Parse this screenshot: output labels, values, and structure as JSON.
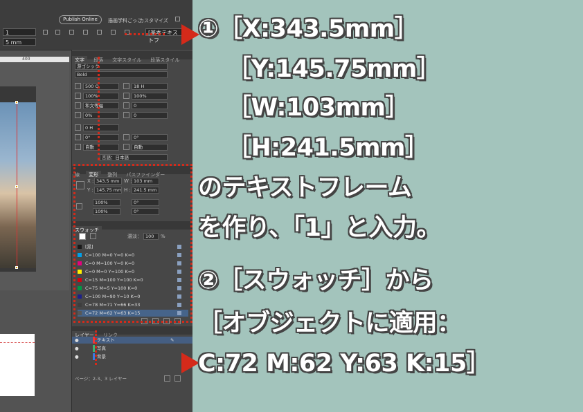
{
  "topbar": {
    "publish_label": "Publish Online",
    "title_text": "描画学科ごっこ",
    "menu_text": "カスタマイズ",
    "field_pt": "1",
    "field_mm": "5 mm",
    "style_text": "[基本テキストフ"
  },
  "ruler": {
    "mark": "400"
  },
  "panel": {
    "char_tabs": [
      "文字",
      "段落",
      "文字スタイル",
      "段落スタイル"
    ],
    "font_name": "游ゴシック",
    "font_style": "Bold",
    "size": "500 Q",
    "leading": "18 H",
    "scale_v": "100%",
    "scale_h": "100%",
    "kerning": "和文等幅",
    "tracking": "0",
    "tsume": "0%",
    "aki": "0",
    "baseline": "0 H",
    "rotate": "0°",
    "skew": "0°",
    "auto1": "自動",
    "auto2": "自動",
    "language": "言語：日本語",
    "transform_tabs": [
      "線",
      "変形",
      "整列",
      "パスファインダー"
    ],
    "x_label": "X :",
    "x_value": "343.5 mm",
    "y_label": "Y :",
    "y_value": "145.75 mm",
    "w_label": "W :",
    "w_value": "103 mm",
    "h_label": "H :",
    "h_value": "241.5 mm",
    "scale_x": "100%",
    "scale_y": "100%",
    "angle": "0°",
    "shear": "0°",
    "swatch_tab": "スウォッチ",
    "tint_label": "濃淡：",
    "tint_value": "100",
    "tint_unit": "%",
    "swatches": [
      {
        "name": "[黒]",
        "color": "#1a1a1a"
      },
      {
        "name": "C=100 M=0 Y=0 K=0",
        "color": "#00a0e9"
      },
      {
        "name": "C=0 M=100 Y=0 K=0",
        "color": "#e4007f"
      },
      {
        "name": "C=0 M=0 Y=100 K=0",
        "color": "#fff100"
      },
      {
        "name": "C=15 M=100 Y=100 K=0",
        "color": "#d7000f"
      },
      {
        "name": "C=75 M=5 Y=100 K=0",
        "color": "#009944"
      },
      {
        "name": "C=100 M=90 Y=10 K=0",
        "color": "#1d2088"
      },
      {
        "name": "C=78 M=71 Y=66 K=33",
        "color": "#3e3e3e"
      },
      {
        "name": "C=72 M=62 Y=63 K=15",
        "color": "#575756"
      }
    ],
    "layer_tabs": [
      "レイヤー",
      "リンク"
    ],
    "layers": [
      {
        "name": "テキスト",
        "color": "#e8383d"
      },
      {
        "name": "写真",
        "color": "#3cb371"
      },
      {
        "name": "背景",
        "color": "#3c7ae0"
      }
    ],
    "footer": "ページ：2-3、3 レイヤー"
  },
  "instructions": {
    "line1": "①［X:343.5mm］",
    "line2": "［Y:145.75mm］",
    "line3": "［W:103mm］",
    "line4": "［H:241.5mm］",
    "line5": "のテキストフレーム",
    "line6": "を作り、「1」と入力。",
    "line7": "②［スウォッチ］から",
    "line8": "［オブジェクトに適用：",
    "line9": "C:72 M:62 Y:63 K:15］"
  },
  "colors": {
    "accent": "#d42a1a",
    "background": "#a3c4bc"
  }
}
